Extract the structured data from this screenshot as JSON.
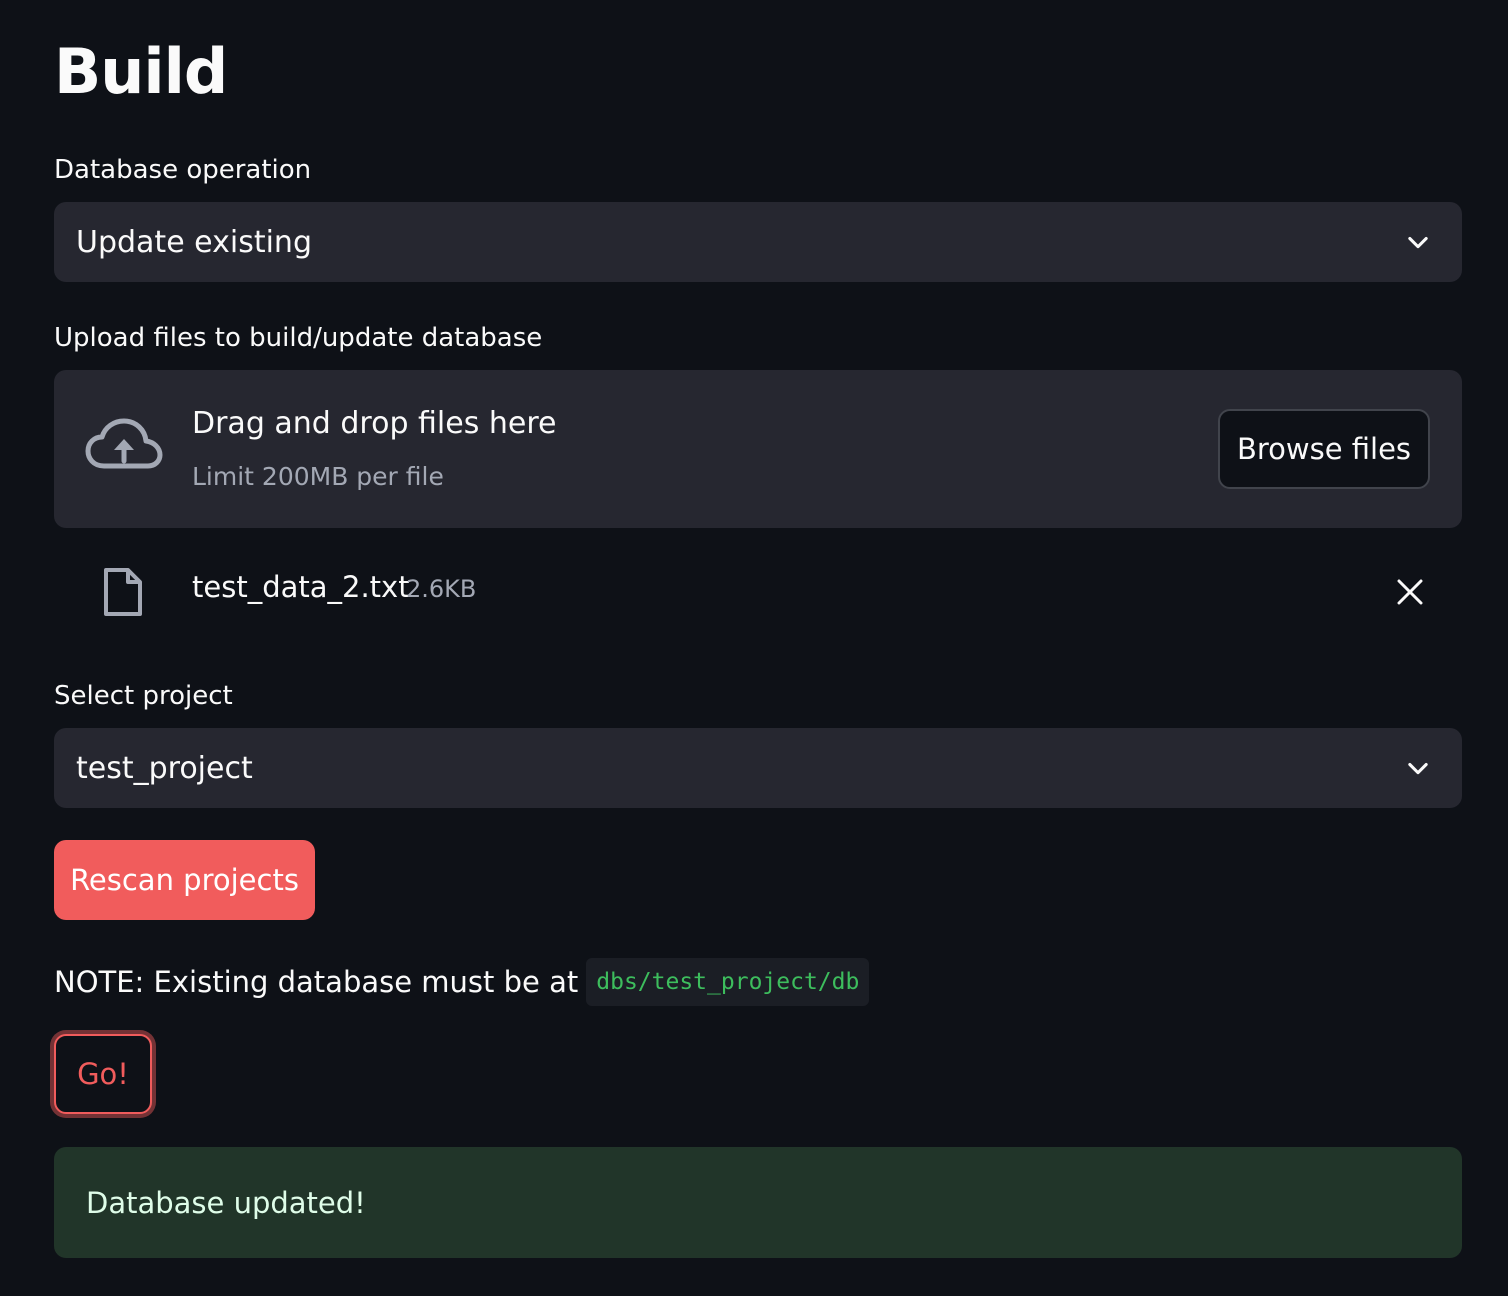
{
  "page": {
    "title": "Build"
  },
  "database_operation": {
    "label": "Database operation",
    "selected": "Update existing"
  },
  "upload": {
    "label": "Upload files to build/update database",
    "dropzone_title": "Drag and drop files here",
    "dropzone_limit": "Limit 200MB per file",
    "browse_label": "Browse files",
    "files": [
      {
        "name": "test_data_2.txt",
        "size": "2.6KB"
      }
    ]
  },
  "project": {
    "label": "Select project",
    "selected": "test_project"
  },
  "rescan_label": "Rescan projects",
  "note": {
    "text": "NOTE: Existing database must be at",
    "path": "dbs/test_project/db"
  },
  "go_label": "Go!",
  "success_message": "Database updated!",
  "colors": {
    "background": "#0e1117",
    "widget": "#262730",
    "primary": "#f15c5c",
    "success_bg": "#213529",
    "code_text": "#3dbd5d"
  }
}
